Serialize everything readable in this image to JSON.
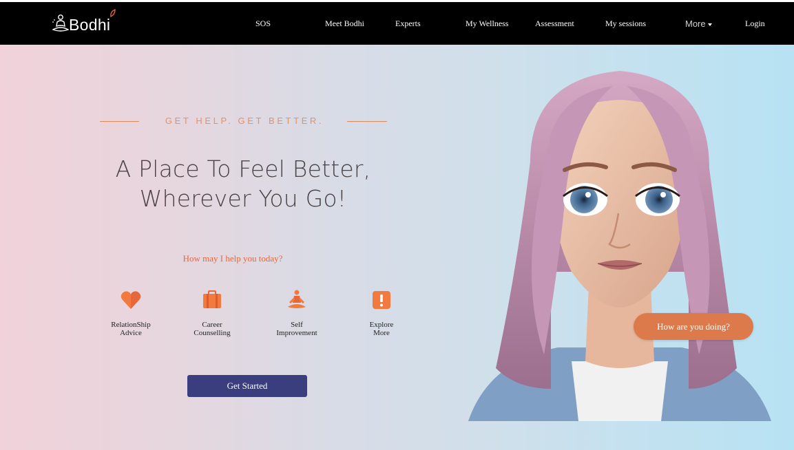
{
  "brand": {
    "name": "Bodhi",
    "accent": "#e8673a",
    "nav_bg": "#000000"
  },
  "nav": {
    "items": [
      {
        "label": "SOS"
      },
      {
        "label": "Meet Bodhi"
      },
      {
        "label": "Experts"
      },
      {
        "label": "My Wellness"
      },
      {
        "label": "Assessment"
      },
      {
        "label": "My sessions"
      }
    ],
    "more_label": "More",
    "more_icon": "chevron-down-icon",
    "login_label": "Login"
  },
  "hero": {
    "tagline": "GET HELP. GET BETTER.",
    "headline_line1": "A Place To Feel Better,",
    "headline_line2": "Wherever You Go!",
    "question": "How may I help you today?",
    "services": [
      {
        "label": "RelationShip\nAdvice",
        "icon": "heart-icon"
      },
      {
        "label": "Career\nCounselling",
        "icon": "briefcase-icon"
      },
      {
        "label": "Self\nImprovement",
        "icon": "meditation-icon"
      },
      {
        "label": "Explore\nMore",
        "icon": "exclamation-icon"
      }
    ],
    "cta_label": "Get Started",
    "cta_color": "#3b3e7e"
  },
  "avatar": {
    "chat_prompt": "How are you doing?",
    "bubble_color": "#dd7a4c",
    "hair_color": "#b88aa8"
  }
}
